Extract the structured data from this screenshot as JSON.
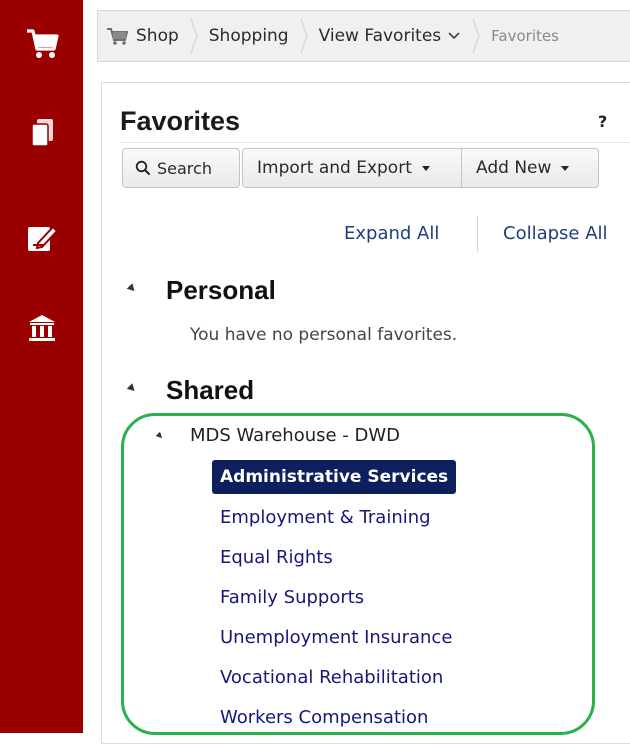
{
  "rail": {
    "icons": [
      "cart-icon",
      "documents-icon",
      "edit-icon",
      "institution-icon"
    ],
    "color": "#9b0000"
  },
  "breadcrumb": {
    "items": [
      "Shop",
      "Shopping",
      "View Favorites",
      "Favorites"
    ]
  },
  "page": {
    "title": "Favorites",
    "help": "?"
  },
  "toolbar": {
    "search_label": "Search",
    "import_export_label": "Import and Export",
    "add_new_label": "Add New"
  },
  "tree_controls": {
    "expand_all": "Expand All",
    "collapse_all": "Collapse All"
  },
  "sections": {
    "personal": {
      "title": "Personal",
      "empty_text": "You have no personal favorites."
    },
    "shared": {
      "title": "Shared",
      "folder": "MDS Warehouse - DWD",
      "items": [
        "Administrative Services",
        "Employment & Training",
        "Equal Rights",
        "Family Supports",
        "Unemployment Insurance",
        "Vocational Rehabilitation",
        "Workers Compensation"
      ],
      "selected": "Administrative Services"
    }
  },
  "colors": {
    "selected_bg": "#0d1f5c",
    "link": "#17177a",
    "highlight_outline": "#2ab04c"
  }
}
